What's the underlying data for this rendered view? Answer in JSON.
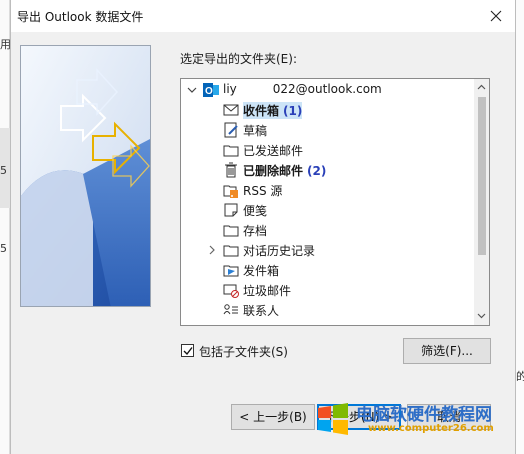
{
  "background": {
    "left_chars": [
      "用",
      "5",
      "5"
    ],
    "right_char": "的"
  },
  "dialog": {
    "title": "导出 Outlook 数据文件",
    "folder_label": "选定导出的文件夹(E):",
    "account": "liy   022@outlook.com",
    "folders": [
      {
        "name": "收件箱",
        "count": "(1)",
        "icon": "inbox-icon"
      },
      {
        "name": "草稿",
        "count": "",
        "icon": "drafts-icon"
      },
      {
        "name": "已发送邮件",
        "count": "",
        "icon": "sent-icon"
      },
      {
        "name": "已删除邮件",
        "count": "(2)",
        "icon": "trash-icon"
      },
      {
        "name": "RSS 源",
        "count": "",
        "icon": "rss-icon"
      },
      {
        "name": "便笺",
        "count": "",
        "icon": "notes-icon"
      },
      {
        "name": "存档",
        "count": "",
        "icon": "archive-icon"
      },
      {
        "name": "对话历史记录",
        "count": "",
        "icon": "folder-icon"
      },
      {
        "name": "发件箱",
        "count": "",
        "icon": "outbox-icon"
      },
      {
        "name": "垃圾邮件",
        "count": "",
        "icon": "junk-icon"
      },
      {
        "name": "联系人",
        "count": "",
        "icon": "contacts-icon"
      }
    ],
    "include_subfolders_label": "包括子文件夹(S)",
    "include_subfolders_checked": true,
    "filter_label": "筛选(F)...",
    "back_label": "< 上一步(B)",
    "next_label": "下一步(N) >",
    "cancel_label": "取消"
  },
  "watermark": {
    "text": "电脑软硬件教程网",
    "url": "www.computer26.com"
  },
  "colors": {
    "accent": "#0078d7",
    "count_blue": "#2a40b8",
    "selection": "#cce4f7"
  }
}
